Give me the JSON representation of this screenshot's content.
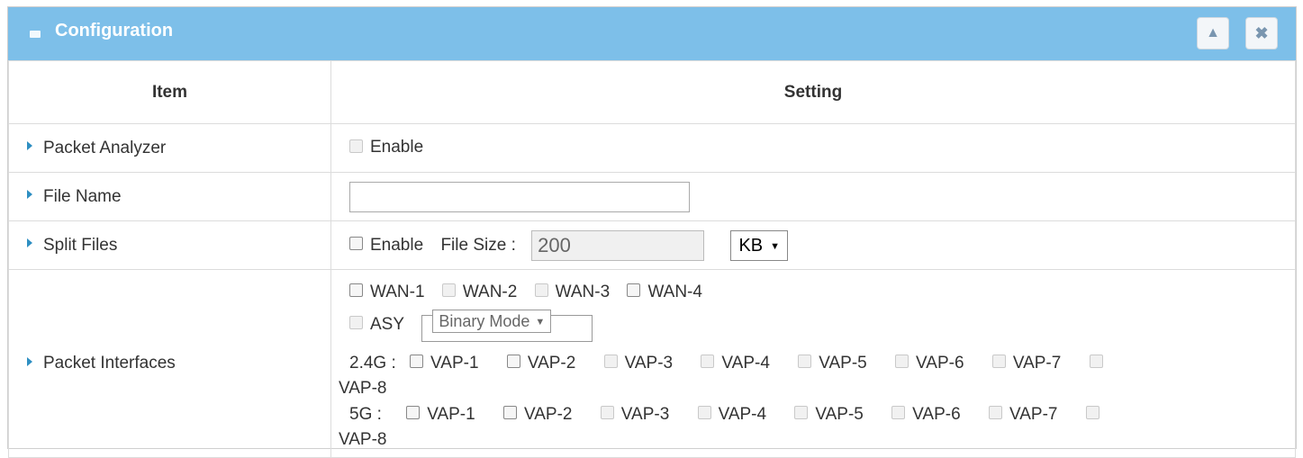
{
  "panel": {
    "title": "Configuration",
    "collapse_icon": "chevron-up-icon",
    "close_icon": "close-icon"
  },
  "table": {
    "headers": {
      "item": "Item",
      "setting": "Setting"
    },
    "packet_analyzer": {
      "label": "Packet Analyzer",
      "enable_label": "Enable",
      "enabled": false
    },
    "file_name": {
      "label": "File Name",
      "value": ""
    },
    "split_files": {
      "label": "Split Files",
      "enable_label": "Enable",
      "file_size_label": "File Size :",
      "file_size_value": "200",
      "unit": "KB"
    },
    "packet_interfaces": {
      "label": "Packet Interfaces",
      "wan": [
        "WAN-1",
        "WAN-2",
        "WAN-3",
        "WAN-4"
      ],
      "asy_label": "ASY",
      "asy_mode": "Binary Mode",
      "band_24_label": "2.4G :",
      "band_5_label": "5G  :",
      "vaps": [
        "VAP-1",
        "VAP-2",
        "VAP-3",
        "VAP-4",
        "VAP-5",
        "VAP-6",
        "VAP-7",
        "VAP-8"
      ]
    }
  }
}
